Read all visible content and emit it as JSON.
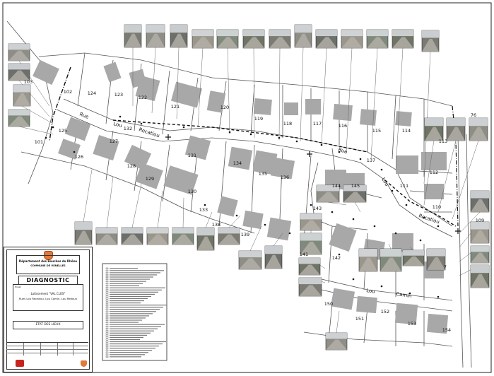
{
  "map": {
    "lots": [
      {
        "num": "124"
      },
      {
        "num": "123"
      },
      {
        "num": "122"
      },
      {
        "num": "121"
      },
      {
        "num": "120"
      },
      {
        "num": "119"
      },
      {
        "num": "118"
      },
      {
        "num": "117"
      },
      {
        "num": "116"
      },
      {
        "num": "115"
      },
      {
        "num": "114"
      },
      {
        "num": "113"
      },
      {
        "num": "112"
      },
      {
        "num": "111"
      },
      {
        "num": "110"
      },
      {
        "num": "109"
      },
      {
        "num": "125"
      },
      {
        "num": "126"
      },
      {
        "num": "127"
      },
      {
        "num": "128"
      },
      {
        "num": "129"
      },
      {
        "num": "130"
      },
      {
        "num": "131"
      },
      {
        "num": "132"
      },
      {
        "num": "133"
      },
      {
        "num": "134"
      },
      {
        "num": "135"
      },
      {
        "num": "136"
      },
      {
        "num": "137"
      },
      {
        "num": "138"
      },
      {
        "num": "139"
      },
      {
        "num": "143"
      },
      {
        "num": "144"
      },
      {
        "num": "145"
      },
      {
        "num": "142"
      },
      {
        "num": "141"
      },
      {
        "num": "150"
      },
      {
        "num": "151"
      },
      {
        "num": "152"
      },
      {
        "num": "153"
      },
      {
        "num": "154"
      },
      {
        "num": "101"
      },
      {
        "num": "102"
      },
      {
        "num": "103"
      },
      {
        "num": "76"
      },
      {
        "num": "7"
      }
    ],
    "streets": [
      {
        "text": "Rue"
      },
      {
        "text": "Lou"
      },
      {
        "text": "Recatiou"
      },
      {
        "text": "Rue"
      },
      {
        "text": "Lou"
      },
      {
        "text": "Recatiou"
      },
      {
        "text": "Lou"
      },
      {
        "text": "Camin"
      }
    ],
    "photo_count": 44,
    "legend_line_count": 42
  },
  "cartouche": {
    "department": "Département des Bouches du Rhône",
    "commune": "COMMUNE DE VENELLES",
    "title": "DIAGNOSTIC",
    "project_tag": "Projet",
    "project": "Lotissement \"VAL CLOS\"",
    "streets": "Rues Lou Recatiou, Lou Camin, Lou Redoun",
    "subject": "ETAT DES LIEUX"
  }
}
